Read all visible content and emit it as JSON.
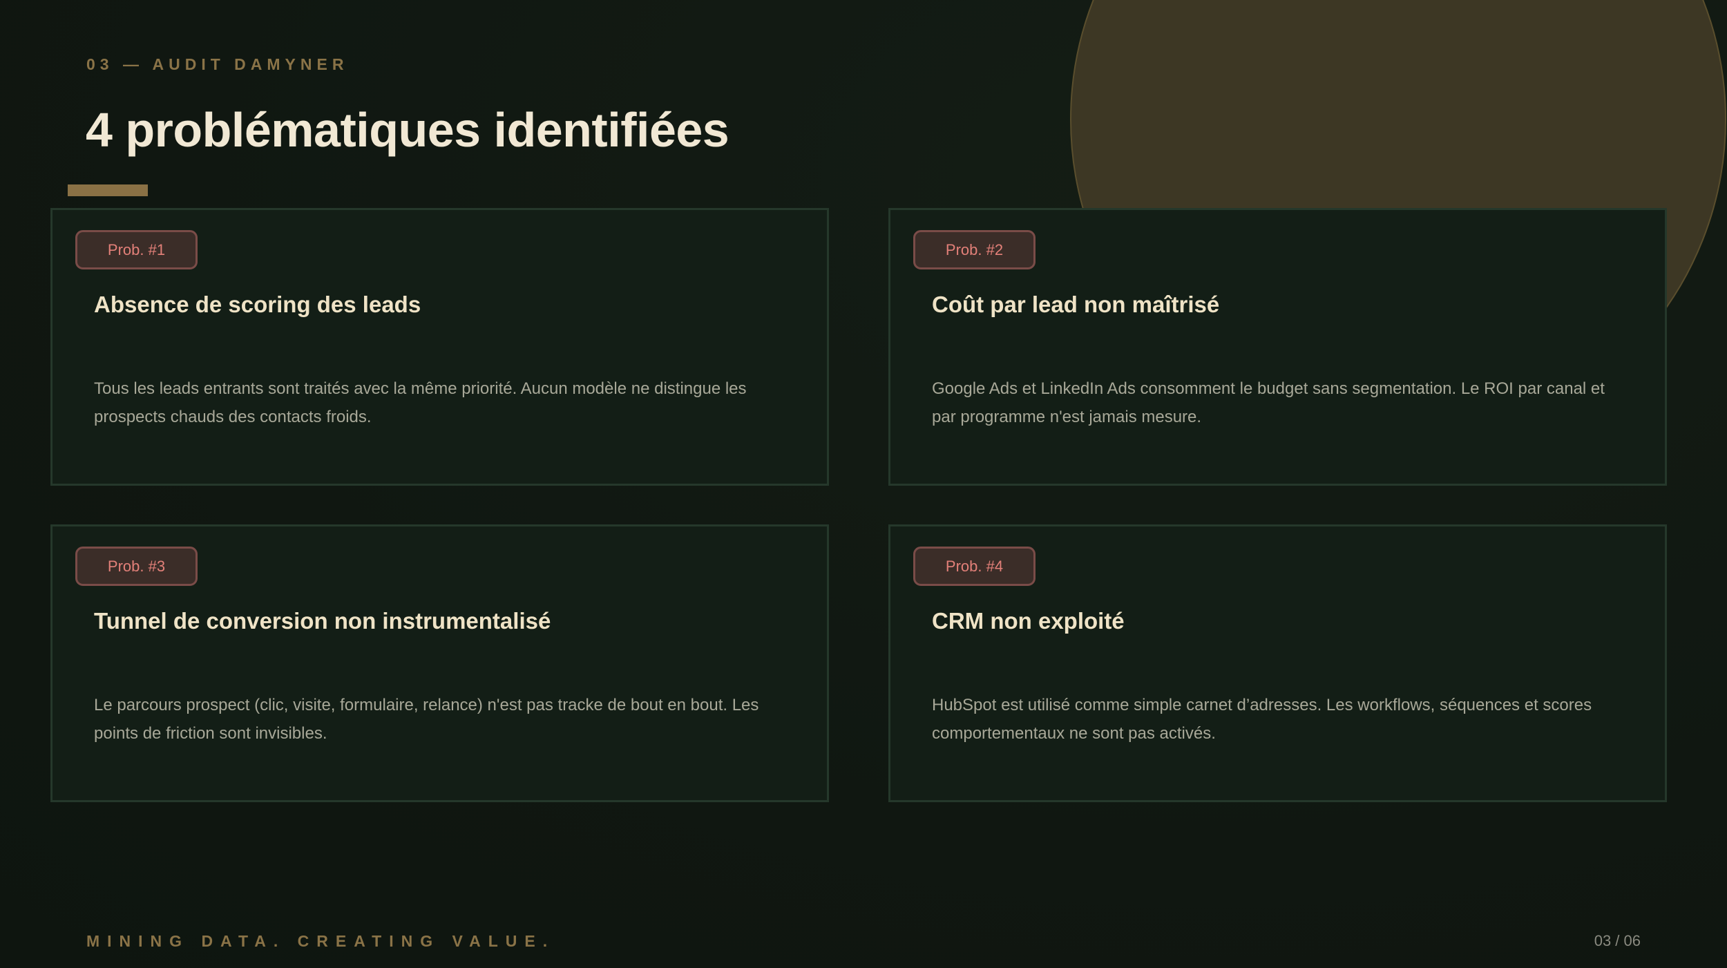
{
  "header": {
    "eyebrow": "03 — AUDIT DAMYNER",
    "title": "4 problématiques identifiées"
  },
  "cards": [
    {
      "badge": "Prob. #1",
      "title": "Absence de scoring des leads",
      "description": "Tous les leads entrants sont traités avec la même priorité. Aucun modèle ne distingue les prospects chauds des contacts froids."
    },
    {
      "badge": "Prob. #2",
      "title": "Coût par lead non maîtrisé",
      "description": "Google Ads et LinkedIn Ads consomment le budget sans segmentation. Le ROI par canal et par programme n'est jamais mesure."
    },
    {
      "badge": "Prob. #3",
      "title": "Tunnel de conversion non instrumentalisé",
      "description": "Le parcours prospect (clic, visite, formulaire, relance) n'est pas tracke de bout en bout. Les points de friction sont invisibles."
    },
    {
      "badge": "Prob. #4",
      "title": "CRM non exploité",
      "description": "HubSpot est utilisé comme simple carnet d’adresses. Les workflows, séquences et scores comportementaux ne sont pas activés."
    }
  ],
  "footer": {
    "tagline": "MINING DATA. CREATING VALUE.",
    "page_number": "03 / 06"
  },
  "colors": {
    "background": "#111912",
    "accent_gold": "#8a7347",
    "title_text": "#f1e8d4",
    "badge_text": "#e38079",
    "card_border": "#25382b"
  }
}
